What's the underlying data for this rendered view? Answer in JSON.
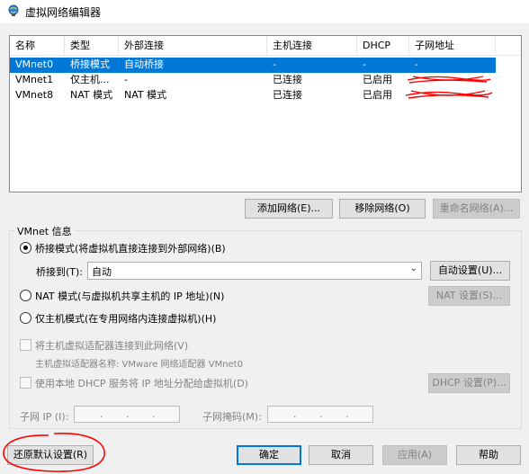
{
  "window": {
    "title": "虚拟网络编辑器",
    "icon": "globe-network-icon"
  },
  "table": {
    "columns": [
      "名称",
      "类型",
      "外部连接",
      "主机连接",
      "DHCP",
      "子网地址"
    ],
    "rows": [
      {
        "name": "VMnet0",
        "type": "桥接模式",
        "external": "自动桥接",
        "host": "-",
        "dhcp": "-",
        "subnet": "-",
        "selected": true
      },
      {
        "name": "VMnet1",
        "type": "仅主机...",
        "external": "-",
        "host": "已连接",
        "dhcp": "已启用",
        "subnet": "",
        "selected": false
      },
      {
        "name": "VMnet8",
        "type": "NAT 模式",
        "external": "NAT 模式",
        "host": "已连接",
        "dhcp": "已启用",
        "subnet": "",
        "selected": false
      }
    ]
  },
  "table_buttons": {
    "add": "添加网络(E)...",
    "remove": "移除网络(O)",
    "rename": "重命名网络(A)..."
  },
  "vmnet_info": {
    "label": "VMnet 信息",
    "bridged_radio": "桥接模式(将虚拟机直接连接到外部网络)(B)",
    "bridged_to_label": "桥接到(T):",
    "bridged_to_value": "自动",
    "auto_settings": "自动设置(U)...",
    "nat_radio": "NAT 模式(与虚拟机共享主机的 IP 地址)(N)",
    "nat_settings": "NAT 设置(S)...",
    "hostonly_radio": "仅主机模式(在专用网络内连接虚拟机)(H)",
    "connect_adapter": "将主机虚拟适配器连接到此网络(V)",
    "adapter_name": "主机虚拟适配器名称: VMware 网络适配器 VMnet0",
    "use_dhcp": "使用本地 DHCP 服务将 IP 地址分配给虚拟机(D)",
    "dhcp_settings": "DHCP 设置(P)...",
    "subnet_ip_label": "子网 IP (I):",
    "subnet_mask_label": "子网掩码(M):",
    "ip_separator": "."
  },
  "footer": {
    "restore": "还原默认设置(R)",
    "ok": "确定",
    "cancel": "取消",
    "apply": "应用(A)",
    "help": "帮助"
  },
  "colors": {
    "selection": "#0078d7",
    "annotation_red": "#ff0000"
  }
}
